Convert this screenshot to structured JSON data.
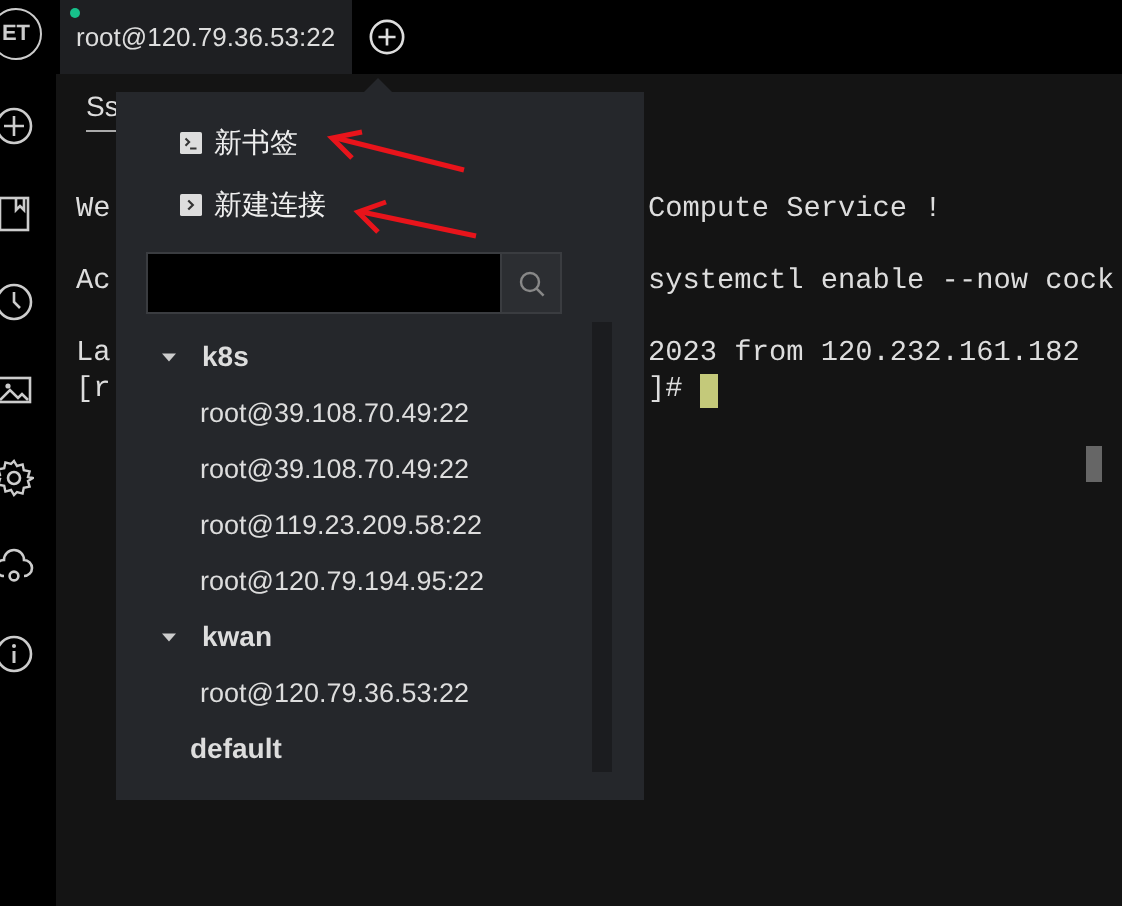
{
  "app": {
    "logo": "ET"
  },
  "tabs": [
    {
      "label": "root@120.79.36.53:22",
      "connected": true,
      "selected": true
    }
  ],
  "session_tabs": [
    {
      "label": "Ss",
      "selected": true
    }
  ],
  "terminal": {
    "blocks": [
      {
        "lines": [
          {
            "left": "We",
            "right": "Compute Service !"
          }
        ]
      },
      {
        "lines": [
          {
            "left": "Ac",
            "right": "systemctl enable --now cock"
          }
        ]
      },
      {
        "lines": [
          {
            "left": "La",
            "right": "2023 from 120.232.161.182"
          },
          {
            "left": "[r",
            "right": "]#",
            "cursor": true
          }
        ]
      }
    ]
  },
  "popup": {
    "menu": [
      {
        "label": "新书签",
        "kind": "bookmark"
      },
      {
        "label": "新建连接",
        "kind": "connection"
      }
    ],
    "tree": [
      {
        "label": "k8s",
        "expanded": true,
        "children": [
          {
            "label": "root@39.108.70.49:22"
          },
          {
            "label": "root@39.108.70.49:22"
          },
          {
            "label": "root@119.23.209.58:22"
          },
          {
            "label": "root@120.79.194.95:22"
          }
        ]
      },
      {
        "label": "kwan",
        "expanded": true,
        "children": [
          {
            "label": "root@120.79.36.53:22"
          }
        ]
      },
      {
        "label": "default"
      }
    ]
  }
}
